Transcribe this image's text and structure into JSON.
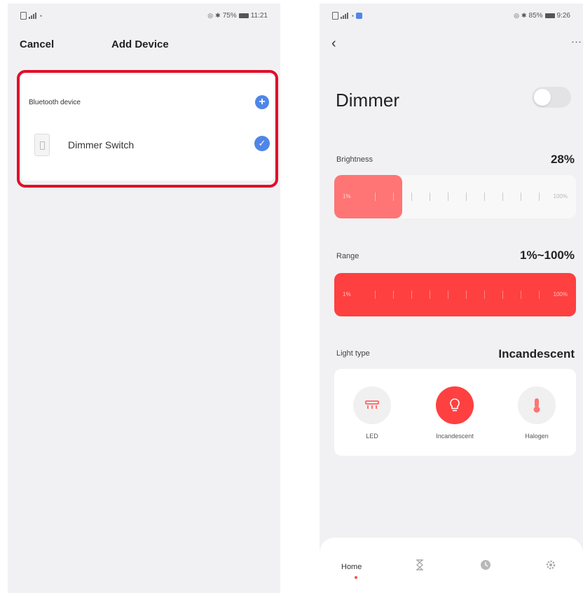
{
  "left": {
    "status_time": "11:21",
    "status_battery": "75%",
    "header": {
      "cancel_label": "Cancel",
      "title": "Add Device"
    },
    "section_label": "Bluetooth device",
    "device": {
      "name": "Dimmer Switch",
      "selected": true
    }
  },
  "right": {
    "status_time": "9:26",
    "status_battery": "85%",
    "title": "Dimmer",
    "power_on": false,
    "brightness": {
      "label": "Brightness",
      "value_text": "28%",
      "value": 0.28,
      "min_label": "1%",
      "max_label": "100%"
    },
    "range": {
      "label": "Range",
      "value_text": "1%~100%",
      "min_label": "1%",
      "max_label": "100%"
    },
    "light_type": {
      "label": "Light type",
      "value": "Incandescent",
      "options": [
        {
          "label": "LED",
          "icon": "led-strip-icon",
          "active": false
        },
        {
          "label": "Incandescent",
          "icon": "bulb-icon",
          "active": true
        },
        {
          "label": "Halogen",
          "icon": "thermometer-icon",
          "active": false
        }
      ]
    },
    "nav": {
      "home_label": "Home",
      "icons": [
        "hourglass-icon",
        "clock-icon",
        "settings-icon"
      ]
    }
  },
  "colors": {
    "accent_red": "#ff4040",
    "brightness_fill": "#ff7474",
    "highlight_outline": "#e10f2a",
    "blue": "#4f86e8"
  }
}
